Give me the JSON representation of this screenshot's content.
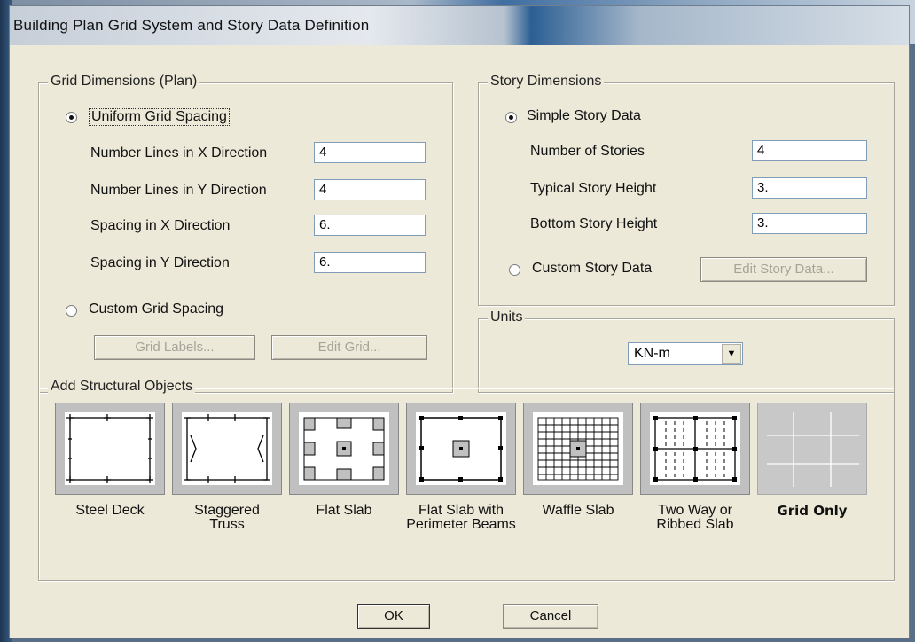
{
  "window": {
    "title": "Building Plan Grid System and Story Data Definition"
  },
  "grid_dimensions": {
    "legend": "Grid Dimensions (Plan)",
    "uniform_label": "Uniform Grid Spacing",
    "uniform_selected": true,
    "fields": [
      {
        "label": "Number Lines in X Direction",
        "value": "4"
      },
      {
        "label": "Number Lines in Y Direction",
        "value": "4"
      },
      {
        "label": "Spacing in X Direction",
        "value": "6."
      },
      {
        "label": "Spacing in Y Direction",
        "value": "6."
      }
    ],
    "custom_label": "Custom Grid Spacing",
    "grid_labels_button": "Grid Labels...",
    "edit_grid_button": "Edit Grid..."
  },
  "story_dimensions": {
    "legend": "Story Dimensions",
    "simple_label": "Simple Story Data",
    "simple_selected": true,
    "fields": [
      {
        "label": "Number of Stories",
        "value": "4"
      },
      {
        "label": "Typical Story Height",
        "value": "3."
      },
      {
        "label": "Bottom Story Height",
        "value": "3."
      }
    ],
    "custom_label": "Custom Story Data",
    "edit_story_button": "Edit Story Data..."
  },
  "units": {
    "legend": "Units",
    "selected": "KN-m"
  },
  "structural_objects": {
    "legend": "Add Structural Objects",
    "items": [
      {
        "label": "Steel Deck",
        "icon": "steel-deck-icon"
      },
      {
        "label": "Staggered\nTruss",
        "icon": "staggered-truss-icon"
      },
      {
        "label": "Flat Slab",
        "icon": "flat-slab-icon"
      },
      {
        "label": "Flat Slab with\nPerimeter Beams",
        "icon": "flat-slab-perimeter-beams-icon"
      },
      {
        "label": "Waffle Slab",
        "icon": "waffle-slab-icon"
      },
      {
        "label": "Two Way or\nRibbed Slab",
        "icon": "two-way-ribbed-slab-icon"
      },
      {
        "label": "Grid Only",
        "icon": "grid-only-icon",
        "selected": true
      }
    ]
  },
  "footer": {
    "ok": "OK",
    "cancel": "Cancel"
  }
}
